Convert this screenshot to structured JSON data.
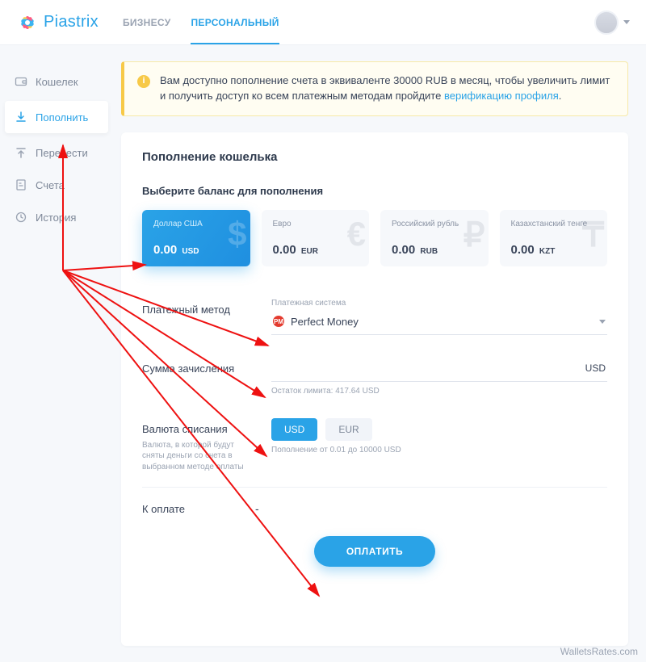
{
  "brand": {
    "name": "Piastrix"
  },
  "header": {
    "tabs": [
      {
        "label": "БИЗНЕСУ",
        "active": false
      },
      {
        "label": "ПЕРСОНАЛЬНЫЙ",
        "active": true
      }
    ]
  },
  "sidebar": {
    "items": [
      {
        "label": "Кошелек",
        "icon": "wallet-icon"
      },
      {
        "label": "Пополнить",
        "icon": "download-icon",
        "active": true
      },
      {
        "label": "Перевести",
        "icon": "upload-icon"
      },
      {
        "label": "Счета",
        "icon": "invoice-icon"
      },
      {
        "label": "История",
        "icon": "history-icon"
      }
    ]
  },
  "notice": {
    "text_prefix": "Вам доступно пополнение счета в эквиваленте 30000 RUB в месяц, чтобы увеличить лимит и получить доступ ко всем платежным методам пройдите ",
    "link_text": "верификацию профиля",
    "text_suffix": "."
  },
  "page": {
    "title": "Пополнение кошелька",
    "balances_label": "Выберите баланс для пополнения",
    "balances": [
      {
        "name": "Доллар США",
        "amount": "0.00",
        "currency": "USD",
        "glyph": "$",
        "selected": true
      },
      {
        "name": "Евро",
        "amount": "0.00",
        "currency": "EUR",
        "glyph": "€"
      },
      {
        "name": "Российский рубль",
        "amount": "0.00",
        "currency": "RUB",
        "glyph": "₽"
      },
      {
        "name": "Казахстанский тенге",
        "amount": "0.00",
        "currency": "KZT",
        "glyph": "₸"
      }
    ],
    "method": {
      "label": "Платежный метод",
      "field_label": "Платежная система",
      "value": "Perfect Money"
    },
    "amount": {
      "label": "Сумма зачисления",
      "suffix": "USD",
      "limit_text": "Остаток лимита: 417.64 USD"
    },
    "debit_currency": {
      "label": "Валюта списания",
      "hint": "Валюта, в которой будут сняты деньги со счета в выбранном методе оплаты",
      "options": [
        "USD",
        "EUR"
      ],
      "selected": "USD",
      "range_text": "Пополнение от 0.01 до 10000 USD"
    },
    "total": {
      "label": "К оплате",
      "value": "-"
    },
    "submit": "ОПЛАТИТЬ"
  },
  "watermark": "WalletsRates.com"
}
